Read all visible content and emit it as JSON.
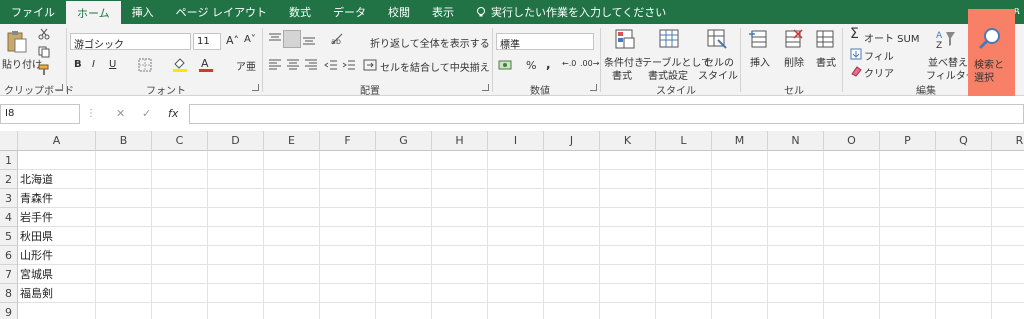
{
  "tabs": [
    {
      "label": "ファイル",
      "active": false
    },
    {
      "label": "ホーム",
      "active": true
    },
    {
      "label": "挿入",
      "active": false
    },
    {
      "label": "ページ レイアウト",
      "active": false
    },
    {
      "label": "数式",
      "active": false
    },
    {
      "label": "データ",
      "active": false
    },
    {
      "label": "校閲",
      "active": false
    },
    {
      "label": "表示",
      "active": false
    }
  ],
  "tell_me": "実行したい作業を入力してください",
  "user_initial": "ጸ",
  "ribbon": {
    "clipboard": {
      "paste": "貼り付け",
      "group": "クリップボード"
    },
    "font": {
      "name": "游ゴシック",
      "size": "11",
      "bold": "B",
      "italic": "I",
      "underline": "U",
      "group": "フォント"
    },
    "alignment": {
      "wrap": "折り返して全体を表示する",
      "merge": "セルを結合して中央揃え",
      "group": "配置"
    },
    "number": {
      "format": "標準",
      "percent": "%",
      "comma": ",",
      "group": "数値"
    },
    "styles": {
      "conditional": "条件付き",
      "conditional2": "書式",
      "table": "テーブルとして",
      "table2": "書式設定",
      "cell": "セルの",
      "cell2": "スタイル",
      "group": "スタイル"
    },
    "cells": {
      "insert": "挿入",
      "delete": "削除",
      "format": "書式",
      "group": "セル"
    },
    "editing": {
      "autosum": "オート SUM",
      "fill": "フィル",
      "clear": "クリア",
      "sort": "並べ替えと",
      "sort2": "フィルター",
      "find": "検索と",
      "find2": "選択",
      "group": "編集"
    }
  },
  "formula_bar": {
    "name_box": "I8",
    "cancel": "✕",
    "enter": "✓",
    "fx": "fx",
    "formula": ""
  },
  "columns": [
    "A",
    "B",
    "C",
    "D",
    "E",
    "F",
    "G",
    "H",
    "I",
    "J",
    "K",
    "L",
    "M",
    "N",
    "O",
    "P",
    "Q",
    "R"
  ],
  "rows": [
    "1",
    "2",
    "3",
    "4",
    "5",
    "6",
    "7",
    "8",
    "9"
  ],
  "cells_A": [
    "",
    "北海道",
    "青森件",
    "岩手件",
    "秋田県",
    "山形件",
    "宮城県",
    "福島剣",
    ""
  ],
  "colors": {
    "accent": "#217346",
    "highlight": "#f88067",
    "font_color_bar": "#e03030",
    "fill_bar": "#ffe600"
  }
}
